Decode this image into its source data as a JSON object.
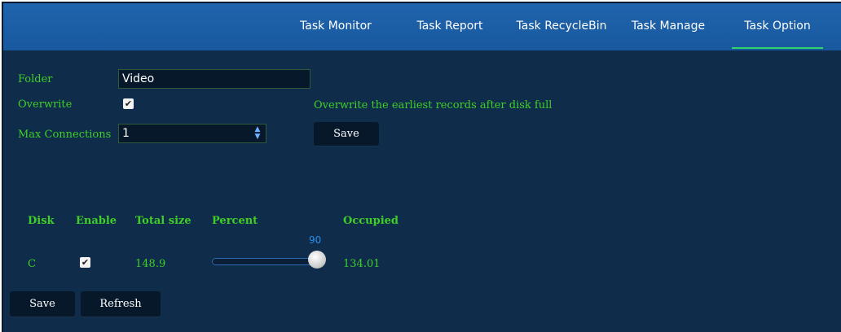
{
  "nav": {
    "tabs": [
      {
        "label": "Task Monitor"
      },
      {
        "label": "Task Report"
      },
      {
        "label": "Task RecycleBin"
      },
      {
        "label": "Task Manage"
      },
      {
        "label": "Task Option",
        "active": true
      }
    ]
  },
  "form": {
    "folder_label": "Folder",
    "folder_value": "Video",
    "overwrite_label": "Overwrite",
    "overwrite_checked": true,
    "overwrite_hint": "Overwrite the earliest records after disk full",
    "max_connections_label": "Max Connections",
    "max_connections_value": "1",
    "save_label": "Save"
  },
  "disk_table": {
    "headers": {
      "disk": "Disk",
      "enable": "Enable",
      "total": "Total size",
      "percent": "Percent",
      "occupied": "Occupied"
    },
    "rows": [
      {
        "disk": "C",
        "enabled": true,
        "total": "148.9",
        "percent": "90",
        "occupied": "134.01"
      }
    ]
  },
  "footer": {
    "save_label": "Save",
    "refresh_label": "Refresh"
  },
  "colors": {
    "background": "#0f2c4b",
    "nav": "#1b5fa6",
    "label_green": "#3fcf27",
    "active_underline": "#2fd46a",
    "slider_value": "#2a8ee8"
  }
}
